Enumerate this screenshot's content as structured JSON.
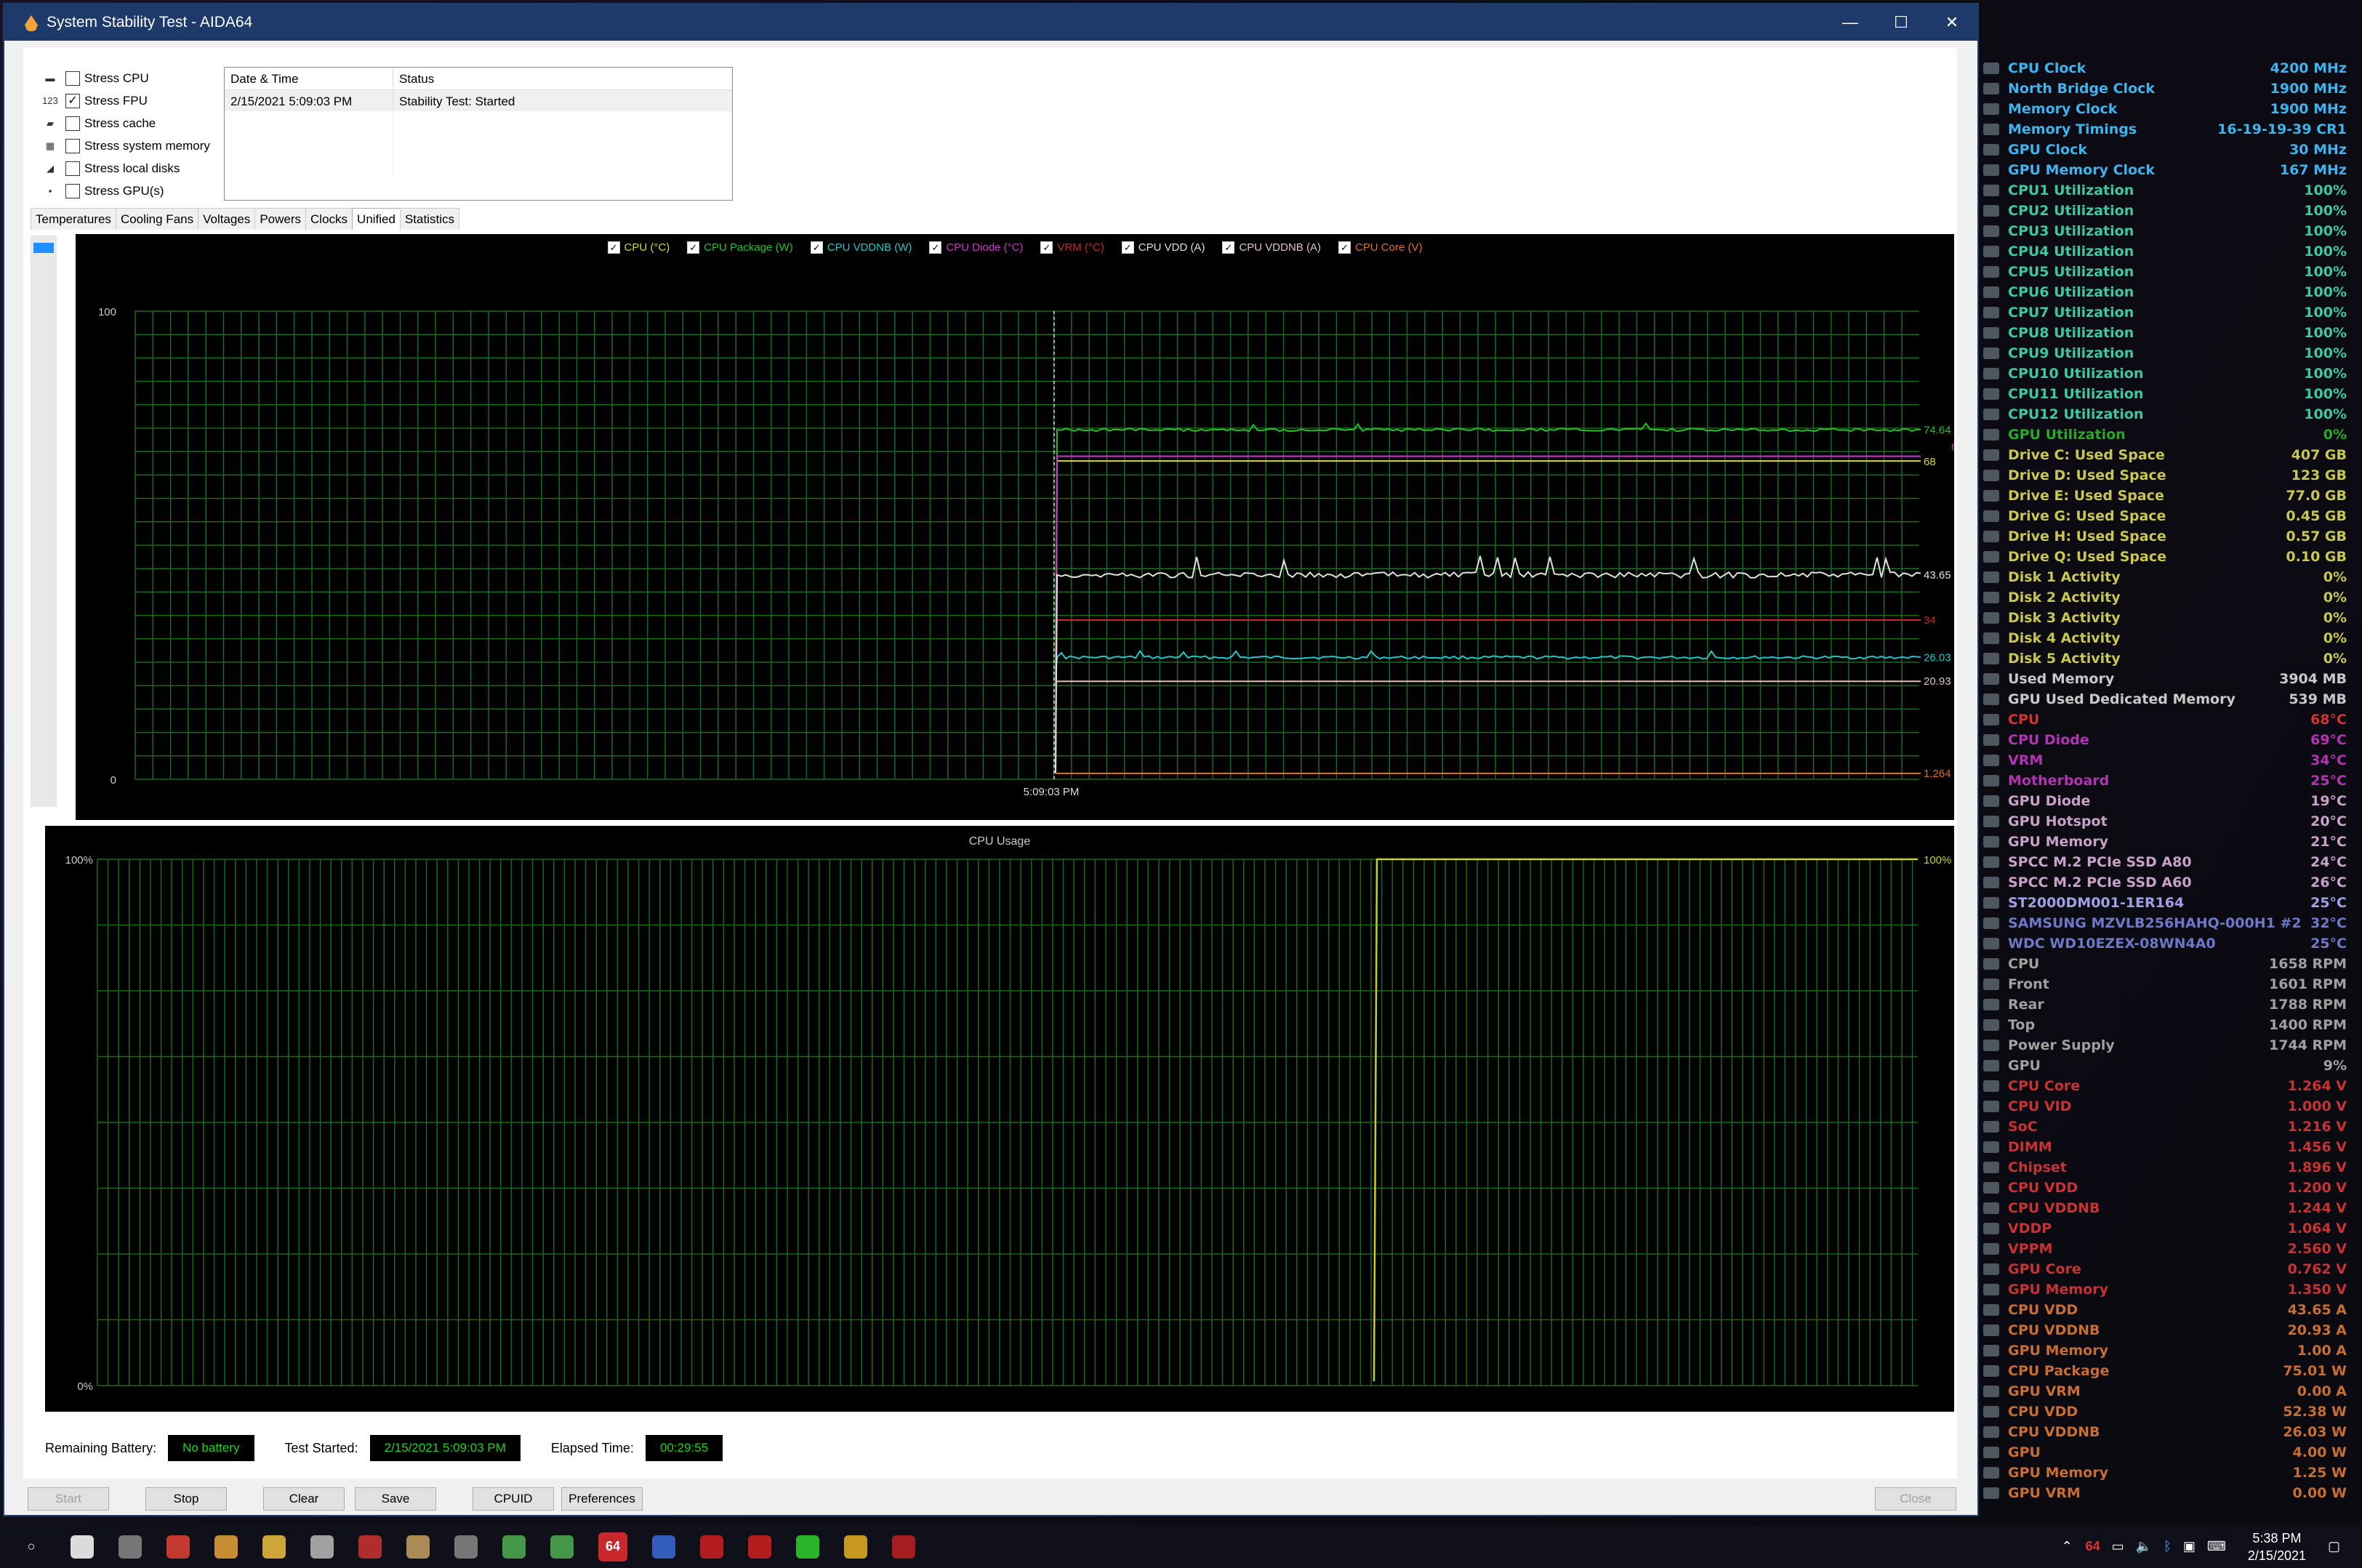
{
  "window": {
    "title": "System Stability Test - AIDA64",
    "minimize": "—",
    "maximize": "☐",
    "close": "✕"
  },
  "stress": [
    {
      "label": "Stress CPU",
      "checked": false
    },
    {
      "label": "Stress FPU",
      "checked": true
    },
    {
      "label": "Stress cache",
      "checked": false
    },
    {
      "label": "Stress system memory",
      "checked": false
    },
    {
      "label": "Stress local disks",
      "checked": false
    },
    {
      "label": "Stress GPU(s)",
      "checked": false
    }
  ],
  "log": {
    "col_datetime": "Date & Time",
    "col_status": "Status",
    "rows": [
      {
        "datetime": "2/15/2021 5:09:03 PM",
        "status": "Stability Test: Started"
      }
    ]
  },
  "tabs": [
    "Temperatures",
    "Cooling Fans",
    "Voltages",
    "Powers",
    "Clocks",
    "Unified",
    "Statistics"
  ],
  "active_tab": "Unified",
  "chart_data": [
    {
      "type": "line",
      "title": "",
      "ylim": [
        0,
        100
      ],
      "y_ticks": [
        "100",
        "0"
      ],
      "x_marker_label": "5:09:03 PM",
      "series": [
        {
          "name": "CPU (°C)",
          "color": "#d8d82a",
          "start": 1.264,
          "end": 68,
          "label": "68"
        },
        {
          "name": "CPU Package (W)",
          "color": "#22c322",
          "start": 20,
          "end": 74.64,
          "label": "74.64"
        },
        {
          "name": "CPU VDDNB (W)",
          "color": "#22c8c8",
          "start": 22,
          "end": 26.03,
          "label": "26.03"
        },
        {
          "name": "CPU Diode (°C)",
          "color": "#d030d0",
          "start": 1.264,
          "end": 69,
          "label": "69"
        },
        {
          "name": "VRM (°C)",
          "color": "#c82828",
          "start": 28,
          "end": 34,
          "label": "34"
        },
        {
          "name": "CPU VDD (A)",
          "color": "#e0e0e0",
          "start": 1.264,
          "end": 43.65,
          "label": "43.65"
        },
        {
          "name": "CPU VDDNB (A)",
          "color": "#e0c0c0",
          "start": 20,
          "end": 20.93,
          "label": "20.93"
        },
        {
          "name": "CPU Core (V)",
          "color": "#e07020",
          "start": 1.264,
          "end": 1.264,
          "label": "1.264"
        }
      ]
    },
    {
      "type": "line",
      "title": "CPU Usage",
      "ylim": [
        0,
        100
      ],
      "y_ticks": [
        "100%",
        "0%"
      ],
      "series": [
        {
          "name": "CPU Usage",
          "color": "#c8d21e",
          "before": 0,
          "after": 100,
          "label": "100%"
        }
      ]
    }
  ],
  "status": {
    "battery_label": "Remaining Battery:",
    "battery_value": "No battery",
    "started_label": "Test Started:",
    "started_value": "2/15/2021 5:09:03 PM",
    "elapsed_label": "Elapsed Time:",
    "elapsed_value": "00:29:55"
  },
  "buttons": {
    "start": "Start",
    "stop": "Stop",
    "clear": "Clear",
    "save": "Save",
    "cpuid": "CPUID",
    "preferences": "Preferences",
    "close": "Close"
  },
  "osd": [
    {
      "name": "CPU Clock",
      "value": "4200 MHz",
      "color": "#3cb4f0"
    },
    {
      "name": "North Bridge Clock",
      "value": "1900 MHz",
      "color": "#3cb4f0"
    },
    {
      "name": "Memory Clock",
      "value": "1900 MHz",
      "color": "#3cb4f0"
    },
    {
      "name": "Memory Timings",
      "value": "16-19-19-39 CR1",
      "color": "#3cb4f0"
    },
    {
      "name": "GPU Clock",
      "value": "30 MHz",
      "color": "#3cb4f0"
    },
    {
      "name": "GPU Memory Clock",
      "value": "167 MHz",
      "color": "#3cb4f0"
    },
    {
      "name": "CPU1 Utilization",
      "value": "100%",
      "color": "#3cc8a0"
    },
    {
      "name": "CPU2 Utilization",
      "value": "100%",
      "color": "#3cc8a0"
    },
    {
      "name": "CPU3 Utilization",
      "value": "100%",
      "color": "#3cc8a0"
    },
    {
      "name": "CPU4 Utilization",
      "value": "100%",
      "color": "#3cc8a0"
    },
    {
      "name": "CPU5 Utilization",
      "value": "100%",
      "color": "#3cc8a0"
    },
    {
      "name": "CPU6 Utilization",
      "value": "100%",
      "color": "#3cc8a0"
    },
    {
      "name": "CPU7 Utilization",
      "value": "100%",
      "color": "#3cc8a0"
    },
    {
      "name": "CPU8 Utilization",
      "value": "100%",
      "color": "#3cc8a0"
    },
    {
      "name": "CPU9 Utilization",
      "value": "100%",
      "color": "#3cc8a0"
    },
    {
      "name": "CPU10 Utilization",
      "value": "100%",
      "color": "#3cc8a0"
    },
    {
      "name": "CPU11 Utilization",
      "value": "100%",
      "color": "#3cc8a0"
    },
    {
      "name": "CPU12 Utilization",
      "value": "100%",
      "color": "#3cc8a0"
    },
    {
      "name": "GPU Utilization",
      "value": "0%",
      "color": "#2aa82a"
    },
    {
      "name": "Drive C: Used Space",
      "value": "407 GB",
      "color": "#c8c850"
    },
    {
      "name": "Drive D: Used Space",
      "value": "123 GB",
      "color": "#c8c850"
    },
    {
      "name": "Drive E: Used Space",
      "value": "77.0 GB",
      "color": "#c8c850"
    },
    {
      "name": "Drive G: Used Space",
      "value": "0.45 GB",
      "color": "#c8c850"
    },
    {
      "name": "Drive H: Used Space",
      "value": "0.57 GB",
      "color": "#c8c850"
    },
    {
      "name": "Drive Q: Used Space",
      "value": "0.10 GB",
      "color": "#c8c850"
    },
    {
      "name": "Disk 1 Activity",
      "value": "0%",
      "color": "#c8c850"
    },
    {
      "name": "Disk 2 Activity",
      "value": "0%",
      "color": "#c8c850"
    },
    {
      "name": "Disk 3 Activity",
      "value": "0%",
      "color": "#c8c850"
    },
    {
      "name": "Disk 4 Activity",
      "value": "0%",
      "color": "#c8c850"
    },
    {
      "name": "Disk 5 Activity",
      "value": "0%",
      "color": "#c8c850"
    },
    {
      "name": "Used Memory",
      "value": "3904 MB",
      "color": "#c8c8c8"
    },
    {
      "name": "GPU Used Dedicated Memory",
      "value": "539 MB",
      "color": "#c8c8c8"
    },
    {
      "name": "CPU",
      "value": "68°C",
      "color": "#d23232"
    },
    {
      "name": "CPU Diode",
      "value": "69°C",
      "color": "#b432b4"
    },
    {
      "name": "VRM",
      "value": "34°C",
      "color": "#b432b4"
    },
    {
      "name": "Motherboard",
      "value": "25°C",
      "color": "#b432b4"
    },
    {
      "name": "GPU Diode",
      "value": "19°C",
      "color": "#c8a0c8"
    },
    {
      "name": "GPU Hotspot",
      "value": "20°C",
      "color": "#c8a0c8"
    },
    {
      "name": "GPU Memory",
      "value": "21°C",
      "color": "#c8a0c8"
    },
    {
      "name": "SPCC M.2 PCIe SSD A80",
      "value": "24°C",
      "color": "#c8a0c8"
    },
    {
      "name": "SPCC M.2 PCIe SSD A60",
      "value": "26°C",
      "color": "#c8a0c8"
    },
    {
      "name": "ST2000DM001-1ER164",
      "value": "25°C",
      "color": "#a0a0e6"
    },
    {
      "name": "SAMSUNG MZVLB256HAHQ-000H1 #2",
      "value": "32°C",
      "color": "#6e78c8"
    },
    {
      "name": "WDC WD10EZEX-08WN4A0",
      "value": "25°C",
      "color": "#6e78c8"
    },
    {
      "name": "CPU",
      "value": "1658 RPM",
      "color": "#a0a0a0"
    },
    {
      "name": "Front",
      "value": "1601 RPM",
      "color": "#a0a0a0"
    },
    {
      "name": "Rear",
      "value": "1788 RPM",
      "color": "#a0a0a0"
    },
    {
      "name": "Top",
      "value": "1400 RPM",
      "color": "#a0a0a0"
    },
    {
      "name": "Power Supply",
      "value": "1744 RPM",
      "color": "#a0a0a0"
    },
    {
      "name": "GPU",
      "value": "9%",
      "color": "#a0a0a0"
    },
    {
      "name": "CPU Core",
      "value": "1.264 V",
      "color": "#c83232"
    },
    {
      "name": "CPU VID",
      "value": "1.000 V",
      "color": "#c83232"
    },
    {
      "name": "SoC",
      "value": "1.216 V",
      "color": "#c83232"
    },
    {
      "name": "DIMM",
      "value": "1.456 V",
      "color": "#c83232"
    },
    {
      "name": "Chipset",
      "value": "1.896 V",
      "color": "#c83232"
    },
    {
      "name": "CPU VDD",
      "value": "1.200 V",
      "color": "#c83232"
    },
    {
      "name": "CPU VDDNB",
      "value": "1.244 V",
      "color": "#c83232"
    },
    {
      "name": "VDDP",
      "value": "1.064 V",
      "color": "#c83232"
    },
    {
      "name": "VPPM",
      "value": "2.560 V",
      "color": "#c83232"
    },
    {
      "name": "GPU Core",
      "value": "0.762 V",
      "color": "#c83232"
    },
    {
      "name": "GPU Memory",
      "value": "1.350 V",
      "color": "#c83232"
    },
    {
      "name": "CPU VDD",
      "value": "43.65 A",
      "color": "#c86e32"
    },
    {
      "name": "CPU VDDNB",
      "value": "20.93 A",
      "color": "#c86e32"
    },
    {
      "name": "GPU Memory",
      "value": "1.00 A",
      "color": "#c86e32"
    },
    {
      "name": "CPU Package",
      "value": "75.01 W",
      "color": "#c86e32"
    },
    {
      "name": "GPU VRM",
      "value": "0.00 A",
      "color": "#c86e32"
    },
    {
      "name": "CPU VDD",
      "value": "52.38 W",
      "color": "#c86e32"
    },
    {
      "name": "CPU VDDNB",
      "value": "26.03 W",
      "color": "#c86e32"
    },
    {
      "name": "GPU",
      "value": "4.00 W",
      "color": "#c86e32"
    },
    {
      "name": "GPU Memory",
      "value": "1.25 W",
      "color": "#c86e32"
    },
    {
      "name": "GPU VRM",
      "value": "0.00 W",
      "color": "#c86e32"
    }
  ],
  "taskbar": {
    "icons": [
      "start-icon",
      "task-view-icon",
      "app-icon",
      "chrome-icon",
      "media-icon",
      "explorer-icon",
      "app-icon",
      "ryzen-icon",
      "audio-icon",
      "monitor-icon",
      "gpu-icon",
      "xbox-icon",
      "aida64-icon",
      "app-icon",
      "flash-icon",
      "cpu-icon",
      "gpuz-icon",
      "shield-icon",
      "app-icon"
    ],
    "aida_label": "64",
    "time": "5:38 PM",
    "date": "2/15/2021"
  }
}
